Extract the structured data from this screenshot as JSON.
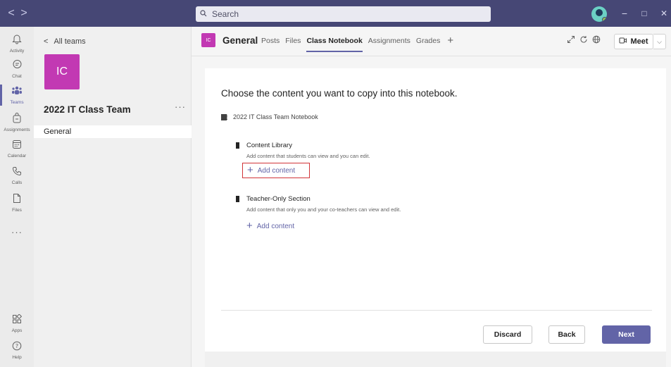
{
  "window": {
    "nav_back": "<",
    "nav_forward": ">",
    "minimize": "−",
    "maximize": "□",
    "close": "✕"
  },
  "search": {
    "placeholder": "Search"
  },
  "rail": [
    {
      "label": "Activity",
      "icon": "bell-icon",
      "glyph": "🔔︎"
    },
    {
      "label": "Chat",
      "icon": "chat-icon",
      "glyph": "☰"
    },
    {
      "label": "Teams",
      "icon": "teams-icon",
      "glyph": "⁂"
    },
    {
      "label": "Assignments",
      "icon": "assignments-icon",
      "glyph": "▣"
    },
    {
      "label": "Calendar",
      "icon": "calendar-icon",
      "glyph": "▦"
    },
    {
      "label": "Calls",
      "icon": "phone-icon",
      "glyph": "✆"
    },
    {
      "label": "Files",
      "icon": "file-icon",
      "glyph": "▯"
    },
    {
      "label": "···",
      "icon": "more-icon",
      "glyph": ""
    },
    {
      "label": "Apps",
      "icon": "apps-icon",
      "glyph": "⊞"
    },
    {
      "label": "Help",
      "icon": "help-icon",
      "glyph": "?"
    }
  ],
  "team": {
    "all_teams": "All teams",
    "initials": "IC",
    "name": "2022 IT Class Team",
    "more": "···",
    "channel": "General"
  },
  "header": {
    "badge": "IC",
    "title": "General",
    "tabs": [
      "Posts",
      "Files",
      "Class Notebook",
      "Assignments",
      "Grades"
    ],
    "active_tab": "Class Notebook",
    "add_tab": "+",
    "meet_label": "Meet",
    "meet_chevron": "⌵"
  },
  "content": {
    "heading": "Choose the content you want to copy into this notebook.",
    "notebook": "2022 IT Class Team Notebook",
    "sections": [
      {
        "title": "Content Library",
        "description": "Add content that students can view and you can edit.",
        "add_label": "Add content"
      },
      {
        "title": "Teacher-Only Section",
        "description": "Add content that only you and your co-teachers can view and edit.",
        "add_label": "Add content"
      }
    ]
  },
  "footer": {
    "discard": "Discard",
    "back": "Back",
    "next": "Next"
  },
  "colors": {
    "titlebar": "#464775",
    "accent": "#6264a7",
    "team_avatar": "#c239b3",
    "highlight_border": "#d13438"
  }
}
